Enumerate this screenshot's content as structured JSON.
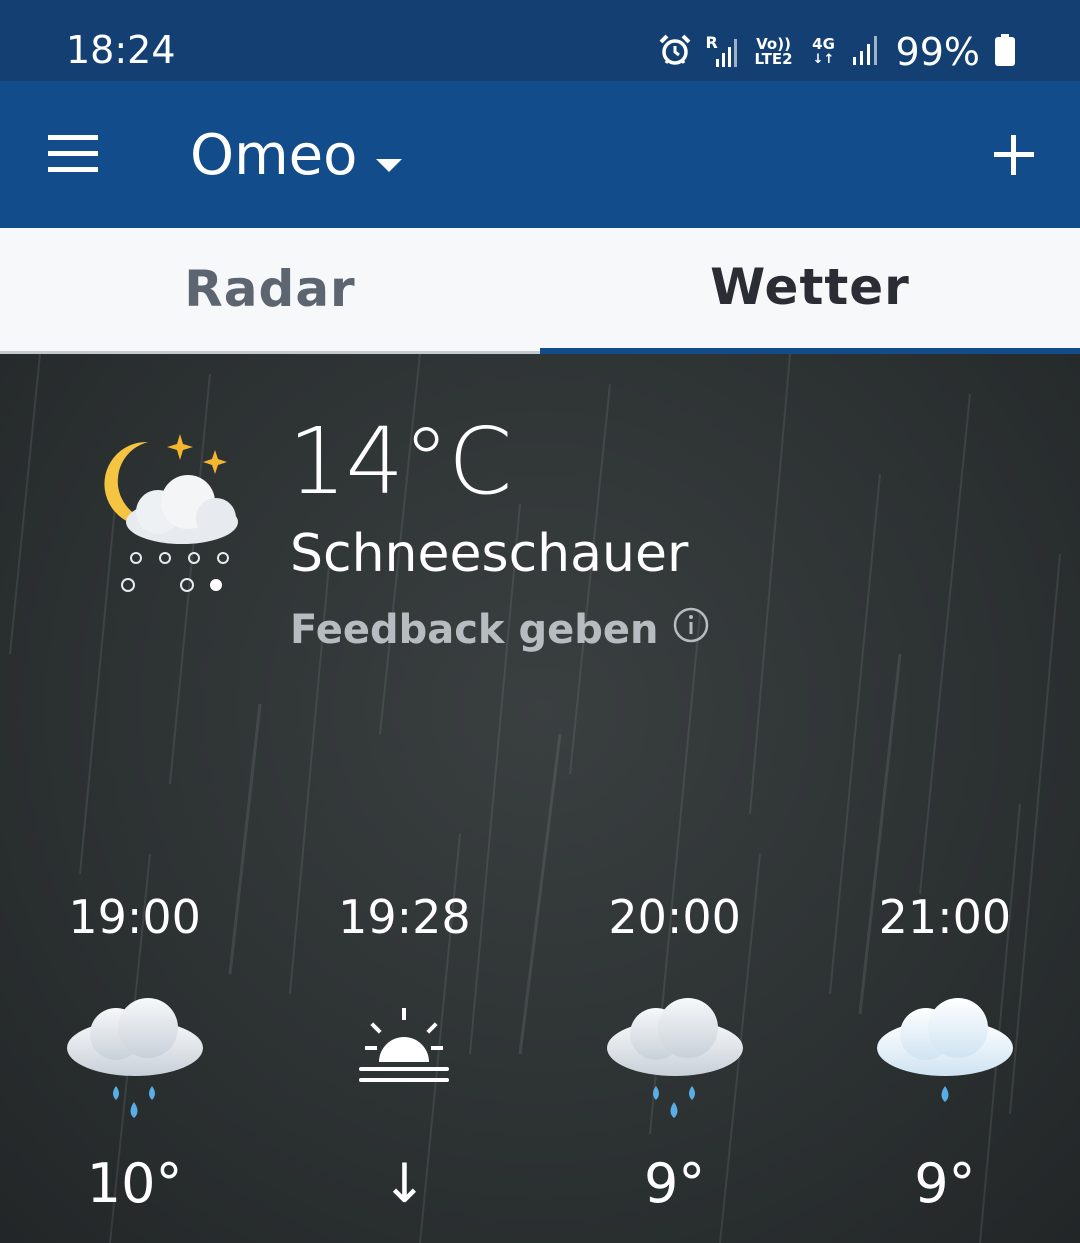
{
  "status_bar": {
    "time": "18:24",
    "battery_text": "99%",
    "roaming_label": "R",
    "volte_label_top": "Vo))",
    "volte_label_bottom": "LTE2",
    "net_label": "4G",
    "icons": [
      "alarm-icon",
      "signal-roaming-icon",
      "volte-icon",
      "data-4g-icon",
      "signal-icon",
      "battery-icon"
    ]
  },
  "app_bar": {
    "location": "Omeo",
    "icons": [
      "menu-icon",
      "dropdown-caret-icon",
      "plus-icon"
    ]
  },
  "tabs": [
    {
      "label": "Radar",
      "active": false
    },
    {
      "label": "Wetter",
      "active": true
    }
  ],
  "current": {
    "temperature": "14°C",
    "description": "Schneeschauer",
    "feedback_label": "Feedback geben",
    "icon": "night-snow-showers-icon"
  },
  "forecast": [
    {
      "time": "19:00",
      "value": "10°",
      "icon": "rain-cloud-icon"
    },
    {
      "time": "19:28",
      "value": "↓",
      "icon": "sunset-icon"
    },
    {
      "time": "20:00",
      "value": "9°",
      "icon": "rain-cloud-icon"
    },
    {
      "time": "21:00",
      "value": "9°",
      "icon": "light-rain-cloud-icon"
    }
  ],
  "colors": {
    "status_bar": "#133f72",
    "app_bar": "#134c8a",
    "tab_bar": "#f7f8fa",
    "tab_indicator": "#134c8a",
    "moon": "#f5c542",
    "rain_drop": "#5aaee6"
  }
}
